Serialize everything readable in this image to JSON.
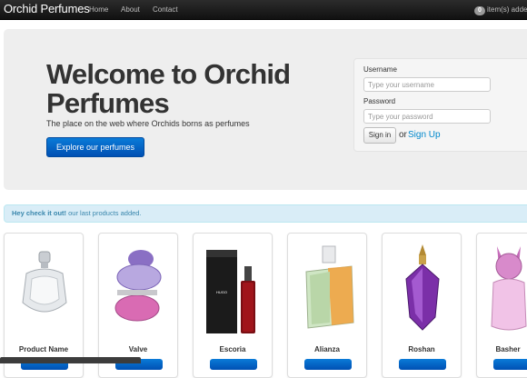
{
  "navbar": {
    "brand": "Orchid Perfumes",
    "links": [
      "Home",
      "About",
      "Contact"
    ],
    "cart_count": "0",
    "cart_label": "item(s) added"
  },
  "hero": {
    "title": "Welcome to Orchid Perfumes",
    "subtitle": "The place on the web where Orchids borns as perfumes",
    "explore_button": "Explore our perfumes"
  },
  "login": {
    "username_label": "Username",
    "username_placeholder": "Type your username",
    "password_label": "Password",
    "password_placeholder": "Type your password",
    "signin_button": "Sign in",
    "or_text": "or",
    "signup_link": "Sign Up"
  },
  "alert": {
    "strong": "Hey check it out!",
    "text": " our last products added."
  },
  "products": [
    {
      "name": "Product Name"
    },
    {
      "name": "Valve"
    },
    {
      "name": "Escoria"
    },
    {
      "name": "Alianza"
    },
    {
      "name": "Roshan"
    },
    {
      "name": "Basher"
    }
  ],
  "colors": {
    "primary": "#0a6fd0",
    "navbar": "#1b1b1b",
    "alert_bg": "#d9edf7",
    "alert_text": "#3a87ad",
    "link": "#0088cc"
  }
}
